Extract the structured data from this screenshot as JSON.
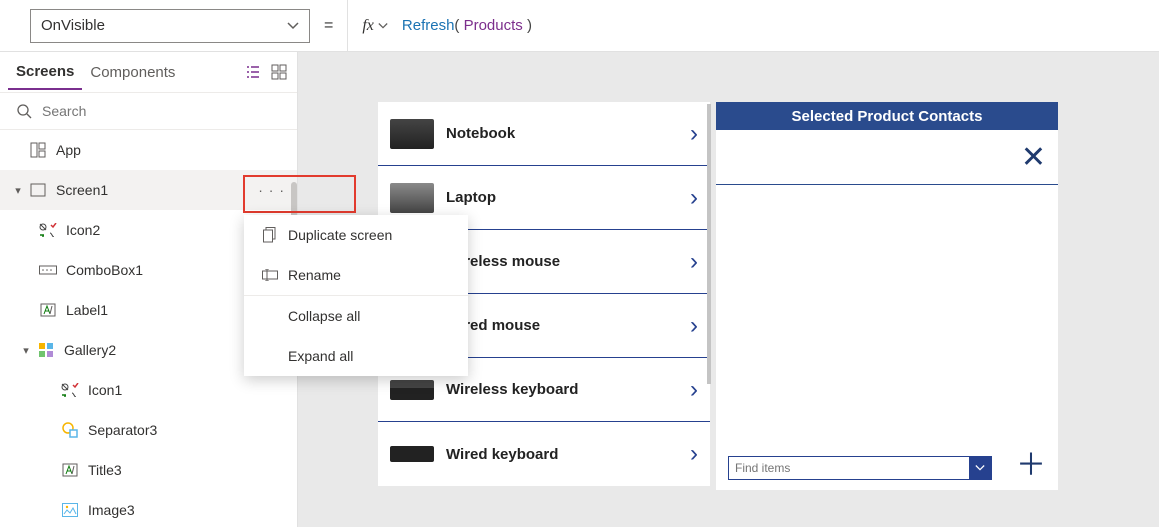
{
  "formula": {
    "property": "OnVisible",
    "func": "Refresh",
    "arg": "Products"
  },
  "tabs": {
    "screens": "Screens",
    "components": "Components"
  },
  "search": {
    "placeholder": "Search"
  },
  "tree": {
    "app": "App",
    "screen1": "Screen1",
    "icon2": "Icon2",
    "combobox1": "ComboBox1",
    "label1": "Label1",
    "gallery2": "Gallery2",
    "icon1": "Icon1",
    "separator3": "Separator3",
    "title3": "Title3",
    "image3": "Image3"
  },
  "ctx": {
    "duplicate": "Duplicate screen",
    "rename": "Rename",
    "collapse": "Collapse all",
    "expand": "Expand all"
  },
  "products": [
    {
      "name": "Notebook"
    },
    {
      "name": "Laptop"
    },
    {
      "name": "Wireless mouse"
    },
    {
      "name": "Wired mouse"
    },
    {
      "name": "Wireless keyboard"
    },
    {
      "name": "Wired keyboard"
    }
  ],
  "side": {
    "header": "Selected Product Contacts",
    "find_placeholder": "Find items"
  }
}
